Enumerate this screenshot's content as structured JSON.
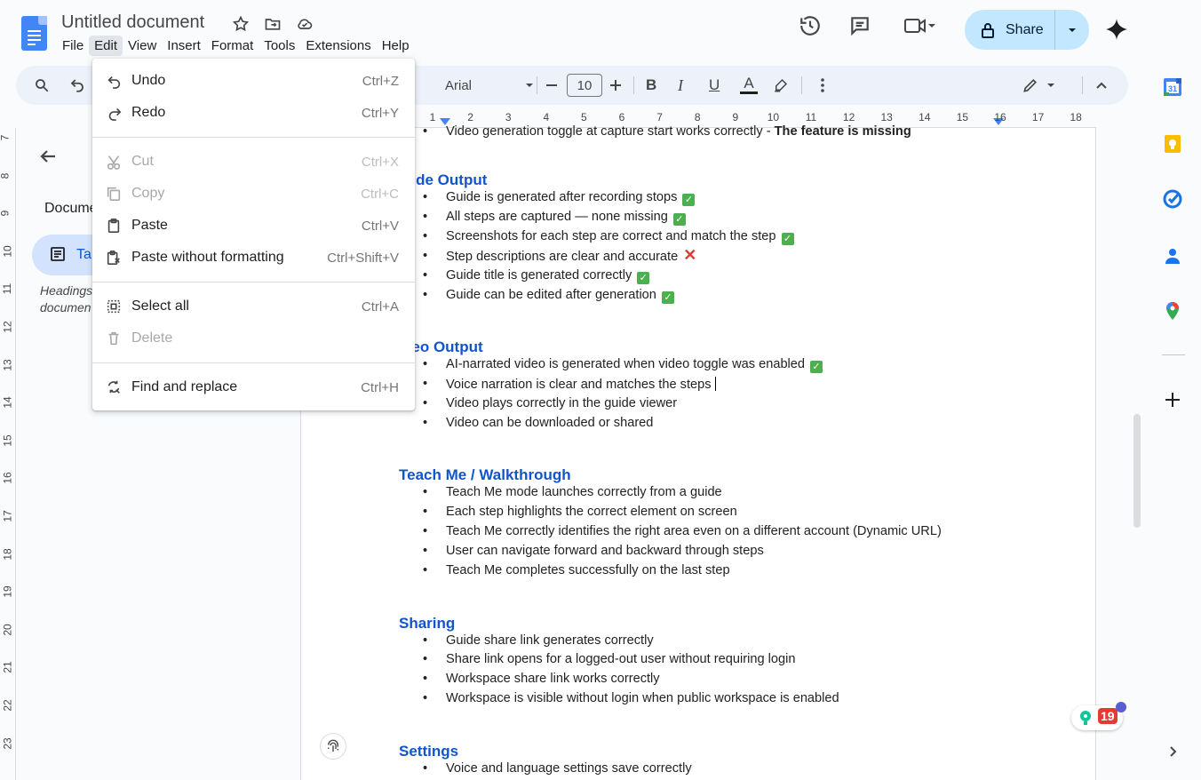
{
  "app": {
    "title": "Untitled document",
    "menus": [
      "File",
      "Edit",
      "View",
      "Insert",
      "Format",
      "Tools",
      "Extensions",
      "Help"
    ],
    "active_menu": "Edit",
    "share_label": "Share"
  },
  "toolbar": {
    "font_name": "Arial",
    "font_size": "10",
    "bold": "B",
    "italic": "I",
    "underline": "U",
    "text_color": "A"
  },
  "ruler": {
    "h_ticks": [
      "1",
      "2",
      "3",
      "4",
      "5",
      "6",
      "7",
      "8",
      "9",
      "10",
      "11",
      "12",
      "13",
      "14",
      "15",
      "16",
      "17",
      "18"
    ],
    "v_ticks": [
      "7",
      "8",
      "9",
      "10",
      "11",
      "12",
      "13",
      "14",
      "15",
      "16",
      "17",
      "18",
      "19",
      "20",
      "21",
      "22",
      "23"
    ]
  },
  "left_panel": {
    "section_label": "Docume",
    "tab_label": "Ta",
    "hint_line1": "Headings",
    "hint_line2": "documen"
  },
  "edit_menu": {
    "items": [
      {
        "label": "Undo",
        "shortcut": "Ctrl+Z",
        "icon": "undo-icon",
        "disabled": false
      },
      {
        "label": "Redo",
        "shortcut": "Ctrl+Y",
        "icon": "redo-icon",
        "disabled": false
      },
      {
        "label": "Cut",
        "shortcut": "Ctrl+X",
        "icon": "cut-icon",
        "disabled": true
      },
      {
        "label": "Copy",
        "shortcut": "Ctrl+C",
        "icon": "copy-icon",
        "disabled": true
      },
      {
        "label": "Paste",
        "shortcut": "Ctrl+V",
        "icon": "paste-icon",
        "disabled": false
      },
      {
        "label": "Paste without formatting",
        "shortcut": "Ctrl+Shift+V",
        "icon": "paste-plain-icon",
        "disabled": false
      },
      {
        "label": "Select all",
        "shortcut": "Ctrl+A",
        "icon": "select-all-icon",
        "disabled": false
      },
      {
        "label": "Delete",
        "shortcut": "",
        "icon": "trash-icon",
        "disabled": true
      },
      {
        "label": "Find and replace",
        "shortcut": "Ctrl+H",
        "icon": "find-replace-icon",
        "disabled": false
      }
    ]
  },
  "document": {
    "top_line": "Video generation toggle at capture start works correctly - ",
    "top_line_bold": "The feature is missing",
    "sections": [
      {
        "heading": "uide Output",
        "items": [
          {
            "text": "Guide is generated after recording stops",
            "mark": "check"
          },
          {
            "text": "All steps are captured — none missing",
            "mark": "check"
          },
          {
            "text": "Screenshots for each step are correct and match the step",
            "mark": "check"
          },
          {
            "text": "Step descriptions are clear and accurate",
            "mark": "cross"
          },
          {
            "text": "Guide title is generated correctly",
            "mark": "check"
          },
          {
            "text": "Guide can be edited after generation",
            "mark": "check"
          }
        ]
      },
      {
        "heading": "deo Output",
        "items": [
          {
            "text": "AI-narrated video is generated when video toggle was enabled",
            "mark": "check"
          },
          {
            "text": "Voice narration is clear and matches the steps",
            "mark": ""
          },
          {
            "text": "Video plays correctly in the guide viewer",
            "mark": ""
          },
          {
            "text": "Video can be downloaded or shared",
            "mark": ""
          }
        ]
      },
      {
        "heading": "Teach Me / Walkthrough",
        "items": [
          {
            "text": "Teach Me mode launches correctly from a guide",
            "mark": ""
          },
          {
            "text": "Each step highlights the correct element on screen",
            "mark": ""
          },
          {
            "text": "Teach Me correctly identifies the right area even on a different account (Dynamic URL)",
            "mark": ""
          },
          {
            "text": "User can navigate forward and backward through steps",
            "mark": ""
          },
          {
            "text": "Teach Me completes successfully on the last step",
            "mark": ""
          }
        ]
      },
      {
        "heading": "Sharing",
        "items": [
          {
            "text": "Guide share link generates correctly",
            "mark": ""
          },
          {
            "text": "Share link opens for a logged-out user without requiring login",
            "mark": ""
          },
          {
            "text": "Workspace share link works correctly",
            "mark": ""
          },
          {
            "text": "Workspace is visible without login when public workspace is enabled",
            "mark": ""
          }
        ]
      },
      {
        "heading": "Settings",
        "items": [
          {
            "text": "Voice and language settings save correctly",
            "mark": ""
          }
        ]
      }
    ]
  },
  "grammarly": {
    "count": "19"
  },
  "colors": {
    "accent": "#0b57d0",
    "heading": "#1155cc",
    "share_bg": "#c2e7ff"
  }
}
